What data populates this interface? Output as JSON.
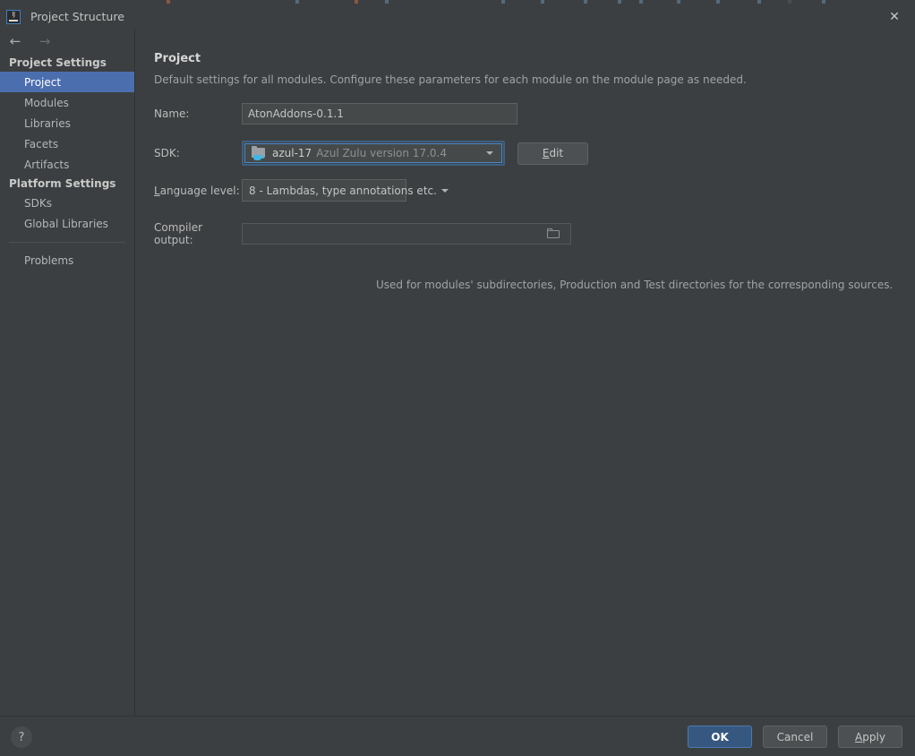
{
  "window": {
    "title": "Project Structure",
    "app_icon": "intellij-idea-icon",
    "close_label": "✕"
  },
  "navigation": {
    "back_arrow": "←",
    "forward_arrow": "→"
  },
  "sidebar": {
    "groups": [
      {
        "title": "Project Settings",
        "items": [
          {
            "label": "Project",
            "selected": true
          },
          {
            "label": "Modules",
            "selected": false
          },
          {
            "label": "Libraries",
            "selected": false
          },
          {
            "label": "Facets",
            "selected": false
          },
          {
            "label": "Artifacts",
            "selected": false
          }
        ]
      },
      {
        "title": "Platform Settings",
        "items": [
          {
            "label": "SDKs",
            "selected": false
          },
          {
            "label": "Global Libraries",
            "selected": false
          }
        ]
      }
    ],
    "problems_item": {
      "label": "Problems",
      "selected": false
    }
  },
  "main": {
    "title": "Project",
    "description": "Default settings for all modules. Configure these parameters for each module on the module page as needed.",
    "fields": {
      "name": {
        "label": "Name:",
        "value": "AtonAddons-0.1.1",
        "placeholder": ""
      },
      "sdk": {
        "label": "SDK:",
        "icon": "java-sdk-folder-icon",
        "name": "azul-17",
        "version": "Azul Zulu version 17.0.4",
        "edit_button": "Edit",
        "edit_button_mnemonic": "E"
      },
      "language_level": {
        "label_prefix": "",
        "label_mnemonic": "L",
        "label_suffix": "anguage level:",
        "value": "8 - Lambdas, type annotations etc."
      },
      "compiler_output": {
        "label": "Compiler output:",
        "value": "",
        "placeholder": "",
        "browse_icon": "folder-browse-icon",
        "hint": "Used for modules' subdirectories, Production and Test directories for the corresponding sources."
      }
    }
  },
  "footer": {
    "help_label": "?",
    "buttons": [
      {
        "label": "OK",
        "style": "default"
      },
      {
        "label": "Cancel",
        "style": "normal"
      },
      {
        "label": "Apply",
        "style": "normal",
        "mnemonic": "A"
      }
    ],
    "apply_prefix": "",
    "apply_mnemonic": "A",
    "apply_suffix": "pply"
  },
  "colors": {
    "dialog_background": "#3c3f41",
    "field_background": "#45494a",
    "selection_blue": "#4b6eaf",
    "default_button_blue": "#365880",
    "focus_ring_blue": "#4a88c7",
    "text_primary": "#bbbbbb",
    "text_secondary": "#a0a3a5",
    "sdk_icon_accent": "#40b6e0"
  }
}
